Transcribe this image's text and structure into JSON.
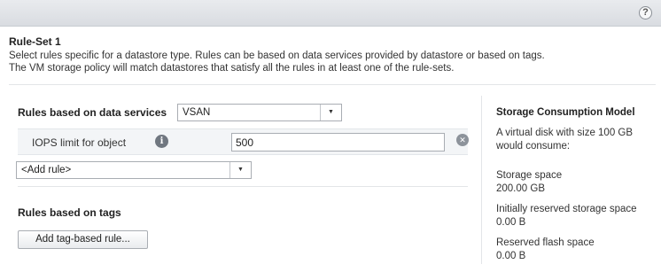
{
  "header": {
    "help_label": "?"
  },
  "ruleset": {
    "title": "Rule-Set 1",
    "description_line1": "Select rules specific for a datastore type. Rules can be based on data services provided by datastore or based on tags.",
    "description_line2": "The VM storage policy will match datastores that satisfy all the rules in at least one of the rule-sets."
  },
  "data_services": {
    "label": "Rules based on data services",
    "provider_select": "VSAN",
    "rules": [
      {
        "label": "IOPS limit for object",
        "value": "500"
      }
    ],
    "add_rule_select": "<Add rule>"
  },
  "tags": {
    "label": "Rules based on tags",
    "add_button": "Add tag-based rule..."
  },
  "consumption": {
    "title": "Storage Consumption Model",
    "intro": "A virtual disk with size 100 GB would consume:",
    "items": [
      {
        "label": "Storage space",
        "value": "200.00 GB"
      },
      {
        "label": "Initially reserved storage space",
        "value": "0.00 B"
      },
      {
        "label": "Reserved flash space",
        "value": "0.00 B"
      }
    ]
  },
  "icons": {
    "help": "help-icon",
    "info": "info-icon",
    "remove": "remove-icon",
    "dropdown": "chevron-down-icon"
  }
}
